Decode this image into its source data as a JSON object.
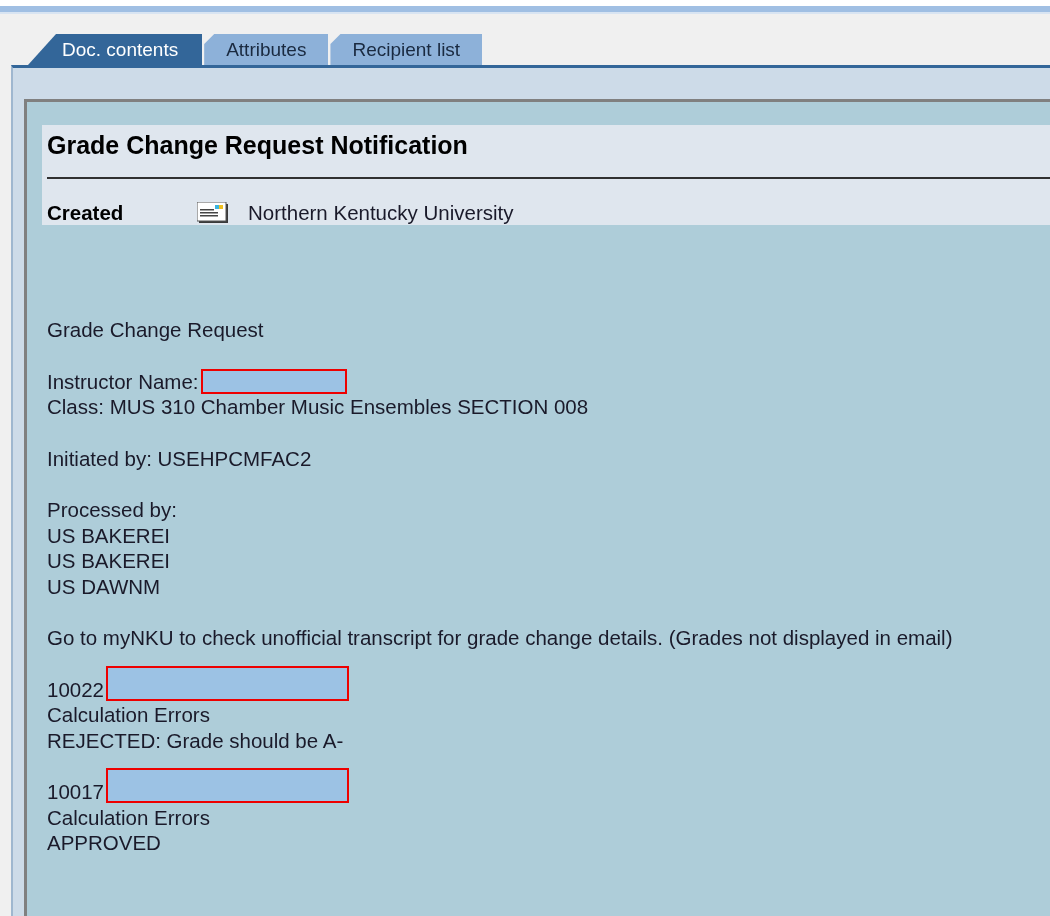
{
  "tabs": [
    {
      "label": "Doc. contents",
      "selected": true
    },
    {
      "label": "Attributes",
      "selected": false
    },
    {
      "label": "Recipient list",
      "selected": false
    }
  ],
  "document": {
    "title": "Grade Change Request Notification",
    "created_label": "Created",
    "created_by": "Northern Kentucky University",
    "paragraphs": [
      [
        {
          "text": "Grade Change Request"
        }
      ],
      [
        {
          "text": "Instructor Name:",
          "redacted": true
        },
        {
          "text": "Class: MUS 310 Chamber Music Ensembles SECTION 008"
        }
      ],
      [
        {
          "text": "Initiated by: USEHPCMFAC2"
        }
      ],
      [
        {
          "text": "Processed by:"
        },
        {
          "text": "US BAKEREI"
        },
        {
          "text": "US BAKEREI"
        },
        {
          "text": "US DAWNM"
        }
      ],
      [
        {
          "text": "Go to myNKU to check unofficial transcript for grade change details. (Grades not displayed in email)"
        }
      ],
      [
        {
          "text": "10022",
          "redacted": true
        },
        {
          "text": "Calculation Errors"
        },
        {
          "text": "REJECTED:  Grade should be A-"
        }
      ],
      [
        {
          "text": "10017",
          "redacted": true
        },
        {
          "text": "Calculation Errors"
        },
        {
          "text": "APPROVED"
        }
      ]
    ]
  }
}
